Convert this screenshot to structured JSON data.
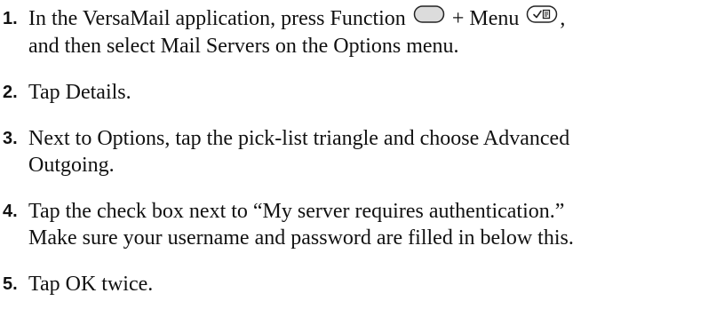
{
  "steps": [
    {
      "number": "1.",
      "line1_part1": "In the VersaMail application, press Function ",
      "function_key_icon": "function-key-icon",
      "line1_part2": " + Menu ",
      "menu_key_icon": "menu-key-icon",
      "line1_part3": ",",
      "line2": "and then select Mail Servers on the Options menu."
    },
    {
      "number": "2.",
      "line1": "Tap Details."
    },
    {
      "number": "3.",
      "line1": "Next to Options, tap the pick-list triangle and choose Advanced",
      "line2": "Outgoing."
    },
    {
      "number": "4.",
      "line1": "Tap the check box next to “My server requires authentication.”",
      "line2": "Make sure your username and password are filled in below this."
    },
    {
      "number": "5.",
      "line1": "Tap OK twice."
    }
  ]
}
